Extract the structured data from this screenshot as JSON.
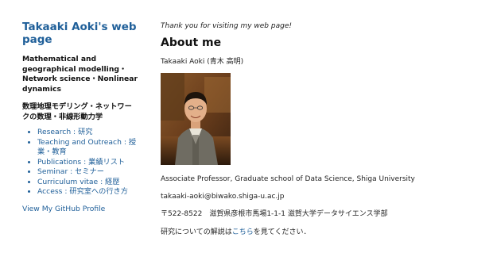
{
  "sidebar": {
    "title": "Takaaki Aoki's web page",
    "tagline_en": "Mathematical and geographical modelling・Network science・Nonlinear dynamics",
    "tagline_ja": "数理地理モデリング・ネットワークの数理・非線形動力学",
    "nav": [
      {
        "label": "Research : 研究"
      },
      {
        "label": "Teaching and Outreach : 授業・教育"
      },
      {
        "label": "Publications : 業績リスト"
      },
      {
        "label": "Seminar : セミナー"
      },
      {
        "label": "Curriculum vitae : 経歴"
      },
      {
        "label": "Access : 研究室への行き方"
      }
    ],
    "github_link": "View My GitHub Profile"
  },
  "main": {
    "thanks": "Thank you for visiting my web page!",
    "heading": "About me",
    "name": "Takaaki Aoki (青木 高明)",
    "position": "Associate Professor, Graduate school of Data Science, Shiga University",
    "email": "takaaki-aoki@biwako.shiga-u.ac.jp",
    "address": "〒522-8522　滋賀県彦根市馬場1-1-1 滋賀大学データサイエンス学部",
    "research_note": {
      "before": "研究についての解説は",
      "link": "こちら",
      "after": "を見てください．"
    }
  },
  "colors": {
    "link": "#1f5f99",
    "text": "#222222"
  }
}
